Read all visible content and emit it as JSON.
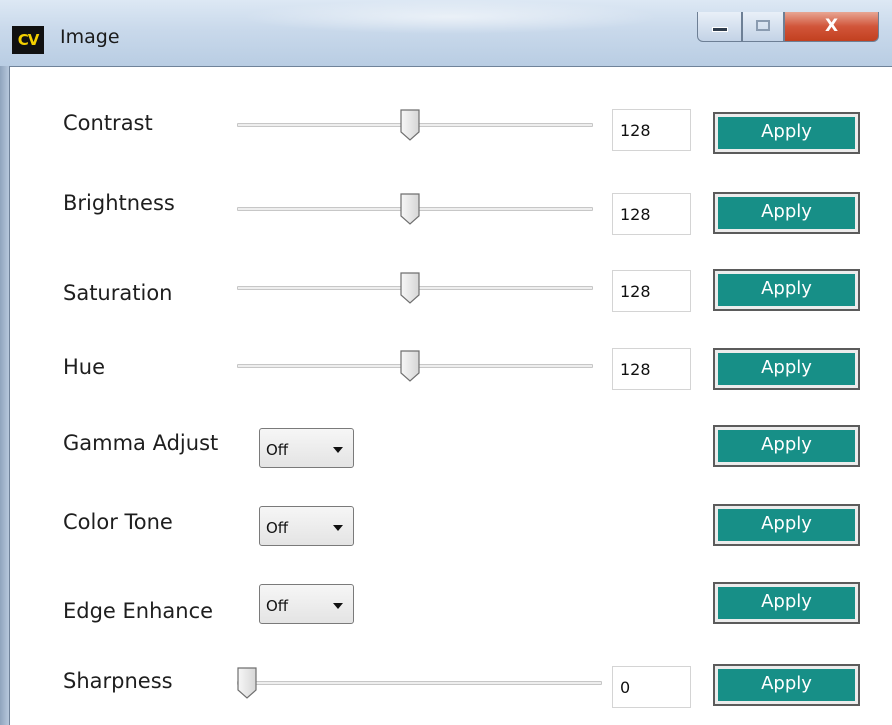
{
  "window": {
    "icon_text": "CV",
    "title": "Image",
    "close_glyph": "X"
  },
  "sliders": [
    {
      "label": "Contrast",
      "value": "128",
      "position": 0.5,
      "apply": "Apply"
    },
    {
      "label": "Brightness",
      "value": "128",
      "position": 0.5,
      "apply": "Apply"
    },
    {
      "label": "Saturation",
      "value": "128",
      "position": 0.5,
      "apply": "Apply"
    },
    {
      "label": "Hue",
      "value": "128",
      "position": 0.5,
      "apply": "Apply"
    }
  ],
  "dropdowns": [
    {
      "label": "Gamma Adjust",
      "selected": "Off",
      "apply": "Apply"
    },
    {
      "label": "Color Tone",
      "selected": "Off",
      "apply": "Apply"
    },
    {
      "label": "Edge Enhance",
      "selected": "Off",
      "apply": "Apply"
    }
  ],
  "sharpness": {
    "label": "Sharpness",
    "value": "0",
    "position": 0.0,
    "apply": "Apply"
  },
  "colors": {
    "apply_button": "#178f87",
    "apply_text": "#ffffff",
    "close_button": "#c2401f"
  },
  "icons": {
    "minimize": "minimize-icon",
    "maximize": "maximize-icon",
    "close": "close-icon",
    "dropdown": "chevron-down-icon"
  }
}
